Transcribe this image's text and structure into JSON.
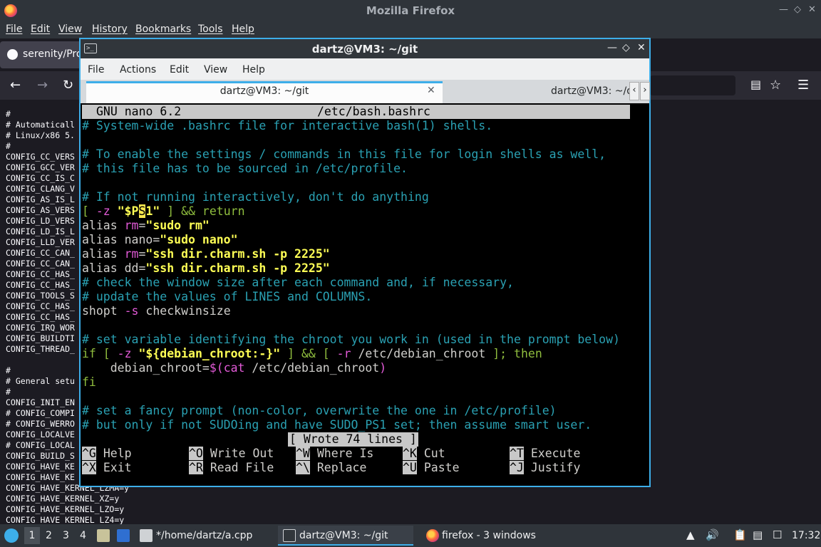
{
  "firefox": {
    "window_title": "Mozilla Firefox",
    "menu": [
      "File",
      "Edit",
      "View",
      "History",
      "Bookmarks",
      "Tools",
      "Help"
    ],
    "tab_title": "serenity/Pro",
    "content_lines": [
      "#",
      "# Automaticall",
      "# Linux/x86 5.",
      "#",
      "CONFIG_CC_VERS",
      "CONFIG_GCC_VER",
      "CONFIG_CC_IS_C",
      "CONFIG_CLANG_V",
      "CONFIG_AS_IS_L",
      "CONFIG_AS_VERS",
      "CONFIG_LD_VERS",
      "CONFIG_LD_IS_L",
      "CONFIG_LLD_VER",
      "CONFIG_CC_CAN_",
      "CONFIG_CC_CAN_",
      "CONFIG_CC_HAS_",
      "CONFIG_CC_HAS_",
      "CONFIG_TOOLS_S",
      "CONFIG_CC_HAS_",
      "CONFIG_CC_HAS_",
      "CONFIG_IRQ_WOR",
      "CONFIG_BUILDTI",
      "CONFIG_THREAD_",
      "",
      "#",
      "# General setu",
      "#",
      "CONFIG_INIT_EN",
      "# CONFIG_COMPI",
      "# CONFIG_WERRO",
      "CONFIG_LOCALVE",
      "# CONFIG_LOCAL",
      "CONFIG_BUILD_S",
      "CONFIG_HAVE_KE",
      "CONFIG_HAVE_KE",
      "CONFIG_HAVE_KERNEL_LZMA=y",
      "CONFIG_HAVE_KERNEL_XZ=y",
      "CONFIG_HAVE_KERNEL_LZO=y",
      "CONFIG_HAVE_KERNEL_LZ4=y"
    ]
  },
  "terminal": {
    "window_title": "dartz@VM3: ~/git",
    "menu": [
      "File",
      "Actions",
      "Edit",
      "View",
      "Help"
    ],
    "tabs": [
      "dartz@VM3: ~/git",
      "dartz@VM3: ~/d"
    ],
    "nano": {
      "header_left": "GNU nano 6.2",
      "header_file": "/etc/bash.bashrc",
      "status": "[ Wrote 74 lines ]",
      "lines": {
        "l1": "# System-wide .bashrc file for interactive bash(1) shells.",
        "l3": "# To enable the settings / commands in this file for login shells as well,",
        "l4": "# this file has to be sourced in /etc/profile.",
        "l6": "# If not running interactively, don't do anything",
        "l12": "# check the window size after each command and, if necessary,",
        "l13": "# update the values of LINES and COLUMNS.",
        "l16": "# set variable identifying the chroot you work in (used in the prompt below)",
        "l21": "# set a fancy prompt (non-color, overwrite the one in /etc/profile)",
        "l22": "# but only if not SUDOing and have SUDO_PS1 set; then assume smart user."
      },
      "shortcuts": [
        {
          "key": "^G",
          "label": "Help"
        },
        {
          "key": "^O",
          "label": "Write Out"
        },
        {
          "key": "^W",
          "label": "Where Is"
        },
        {
          "key": "^K",
          "label": "Cut"
        },
        {
          "key": "^T",
          "label": "Execute"
        },
        {
          "key": "^X",
          "label": "Exit"
        },
        {
          "key": "^R",
          "label": "Read File"
        },
        {
          "key": "^\\",
          "label": "Replace"
        },
        {
          "key": "^U",
          "label": "Paste"
        },
        {
          "key": "^J",
          "label": "Justify"
        }
      ]
    }
  },
  "taskbar": {
    "workspaces": [
      "1",
      "2",
      "3",
      "4"
    ],
    "tasks": [
      "*/home/dartz/a.cpp",
      "dartz@VM3: ~/git",
      "firefox - 3 windows"
    ],
    "clock": "17:32"
  },
  "colors": {
    "accent": "#3daee9",
    "comment": "#2aa1b3",
    "keyword": "#e25ad7",
    "string": "#ffff55",
    "green": "#8fbd3e"
  }
}
